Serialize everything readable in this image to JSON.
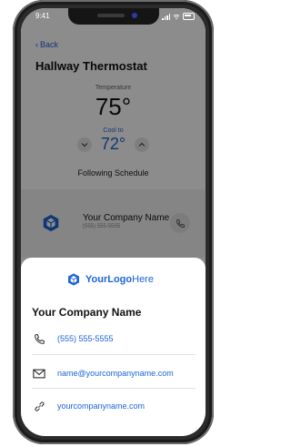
{
  "status_bar": {
    "time": "9:41"
  },
  "app": {
    "back_label": "Back",
    "title": "Hallway Thermostat",
    "temperature_label": "Temperature",
    "temperature_value": "75°",
    "cool_to_label": "Cool to",
    "set_temperature": "72°",
    "schedule_text": "Following Schedule",
    "company_card": {
      "name": "Your Company Name",
      "phone": "(555) 555-5555"
    }
  },
  "sheet": {
    "logo_your": "YourLogo",
    "logo_here": "Here",
    "company_name": "Your Company Name",
    "phone": "(555) 555-5555",
    "email": "name@yourcompanyname.com",
    "website": "yourcompanyname.com"
  },
  "colors": {
    "accent": "#1d63d6",
    "overlay": "rgba(0,0,0,0.45)"
  }
}
